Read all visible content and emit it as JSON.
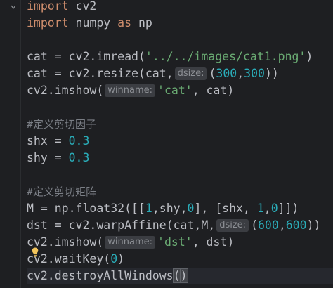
{
  "editor": {
    "lines": {
      "l1": {
        "kw": "import",
        "rest": " cv2"
      },
      "l2": {
        "kw1": "import",
        "mid": " numpy ",
        "kw2": "as",
        "rest": " np"
      },
      "l4": {
        "a": "cat = cv2.imread(",
        "s": "'../../images/cat1.png'",
        "b": ")"
      },
      "l5": {
        "a": "cat = cv2.resize(cat,",
        "hint": "dsize:",
        "b": "(",
        "n1": "300",
        "c": ",",
        "n2": "300",
        "d": "))"
      },
      "l6": {
        "a": "cv2.imshow(",
        "hint": "winname:",
        "s": "'cat'",
        "b": ", cat)"
      },
      "l8": {
        "c": "#定义剪切因子"
      },
      "l9": {
        "a": "shx = ",
        "n": "0.3"
      },
      "l10": {
        "a": "shy = ",
        "n": "0.3"
      },
      "l12": {
        "c": "#定义剪切矩阵"
      },
      "l13": {
        "a": "M = np.float32([[",
        "n1": "1",
        "b": ",shy,",
        "n2": "0",
        "c": "], [shx, ",
        "n3": "1",
        "d": ",",
        "n4": "0",
        "e": "]])"
      },
      "l14": {
        "a": "dst = cv2.warpAffine(cat,M,",
        "hint": "dsize:",
        "b": "(",
        "n1": "600",
        "c": ",",
        "n2": "600",
        "d": "))"
      },
      "l15": {
        "a": "cv2.imshow(",
        "hint": "winname:",
        "s": "'dst'",
        "b": ", dst)"
      },
      "l16": {
        "a": "cv2.waitKey(",
        "n": "0",
        "b": ")"
      },
      "l17": {
        "a": "cv2.destroyAllWindows",
        "p1": "(",
        "p2": ")"
      }
    }
  },
  "colors": {
    "background": "#1e1f22",
    "keyword": "#cf8e6d",
    "string": "#6aab73",
    "number": "#2aacb8",
    "comment": "#7a7e85",
    "text": "#bcbec4",
    "hint_bg": "#3b3d42",
    "bulb": "#f2c55c"
  },
  "icons": {
    "fold": "fold-marker-icon",
    "bulb": "lightbulb-icon"
  }
}
